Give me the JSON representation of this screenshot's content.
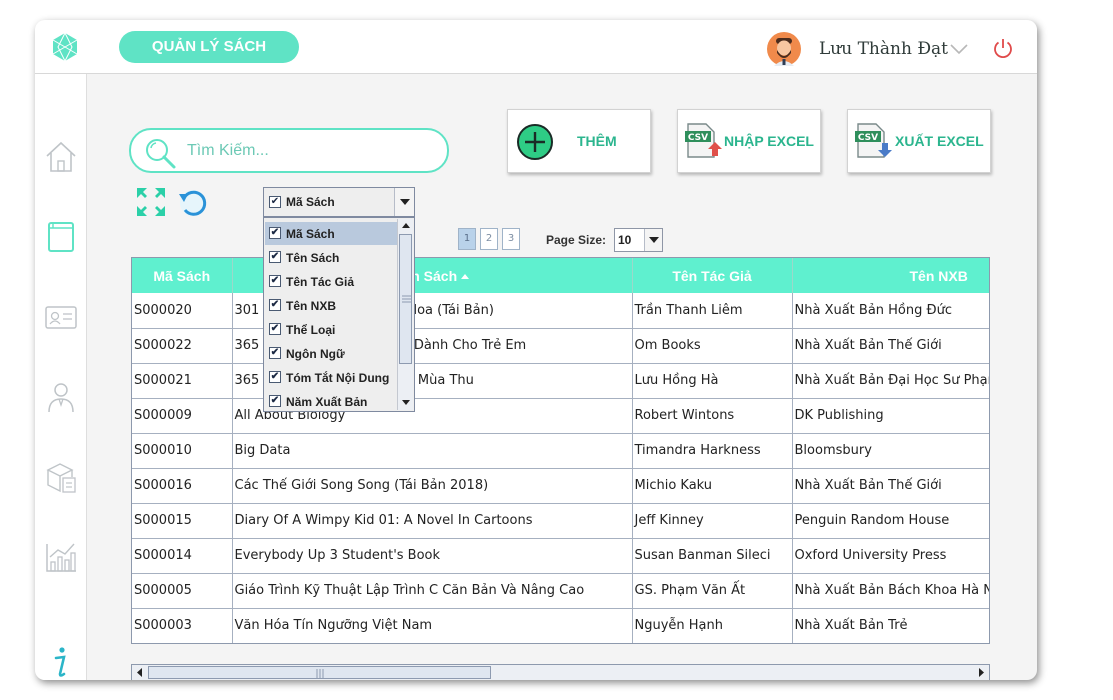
{
  "app": {
    "title": "QUẢN LÝ SÁCH",
    "user_name": "Lưu Thành Đạt",
    "brand_color": "#5fe3c5",
    "accent_color": "#2bb58e"
  },
  "sidebar": {
    "items": [
      {
        "icon": "home-icon"
      },
      {
        "icon": "book-icon"
      },
      {
        "icon": "id-card-icon"
      },
      {
        "icon": "employee-icon"
      },
      {
        "icon": "package-icon"
      },
      {
        "icon": "chart-icon"
      },
      {
        "icon": "info-icon"
      }
    ]
  },
  "search": {
    "placeholder": "Tìm Kiếm..."
  },
  "actions": {
    "add_label": "THÊM",
    "import_label": "NHẬP EXCEL",
    "export_label": "XUẤT EXCEL",
    "csv_tag": "CSV"
  },
  "column_filter": {
    "selected": "Mã Sách",
    "options": [
      {
        "label": "Mã Sách",
        "checked": true
      },
      {
        "label": "Tên Sách",
        "checked": true
      },
      {
        "label": "Tên Tác Giả",
        "checked": true
      },
      {
        "label": "Tên NXB",
        "checked": true
      },
      {
        "label": "Thể Loại",
        "checked": true
      },
      {
        "label": "Ngôn Ngữ",
        "checked": true
      },
      {
        "label": "Tóm Tắt Nội Dung",
        "checked": true
      },
      {
        "label": "Năm Xuất Bản",
        "checked": true
      }
    ]
  },
  "pagination": {
    "pages": [
      "1",
      "2",
      "3"
    ],
    "current": "1",
    "page_size_label": "Page Size:",
    "page_size": "10"
  },
  "table": {
    "columns": [
      "Mã Sách",
      "Tên Sách",
      "Tên Tác Giả",
      "Tên NXB"
    ],
    "sorted_column": "Tên Sách",
    "rows": [
      [
        "S000020",
        "301 Câu Đàm Thoại Tiếng Hoa (Tái Bản)",
        "Trần Thanh Liêm",
        "Nhà Xuất Bản Hồng Đức"
      ],
      [
        "S000022",
        "365 Truyện Kể Hằng Đêm - Dành Cho Trẻ Em",
        "Om Books",
        "Nhà Xuất Bản Thế Giới"
      ],
      [
        "S000021",
        "365 Ngày Yêu Thương - Tập Mùa Thu",
        "Lưu Hồng Hà",
        "Nhà Xuất Bản Đại Học Sư Phạm"
      ],
      [
        "S000009",
        "All About Biology",
        "Robert Wintons",
        "DK Publishing"
      ],
      [
        "S000010",
        "Big Data",
        "Timandra Harkness",
        "Bloomsbury"
      ],
      [
        "S000016",
        "Các Thế Giới Song Song (Tái Bản 2018)",
        "Michio Kaku",
        "Nhà Xuất Bản Thế Giới"
      ],
      [
        "S000015",
        "Diary Of A Wimpy Kid 01: A Novel In Cartoons",
        "Jeff Kinney",
        "Penguin Random House"
      ],
      [
        "S000014",
        "Everybody Up 3 Student's Book",
        "Susan Banman Sileci",
        "Oxford University Press"
      ],
      [
        "S000005",
        "Giáo Trình Kỹ Thuật Lập Trình C Căn Bản Và Nâng Cao",
        "GS. Phạm Văn Ất",
        "Nhà Xuất Bản Bách Khoa Hà Nội"
      ],
      [
        "S000003",
        " Văn Hóa Tín Ngưỡng Việt Nam",
        "Nguyễn Hạnh",
        "Nhà Xuất Bản Trẻ"
      ]
    ]
  }
}
